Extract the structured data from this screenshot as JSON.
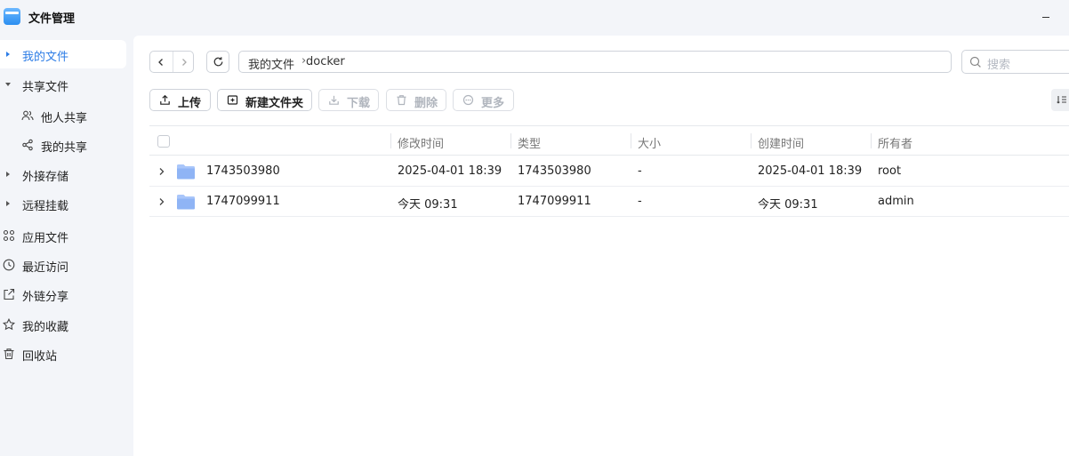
{
  "app": {
    "title": "文件管理"
  },
  "sidebar": {
    "items": [
      {
        "label": "我的文件",
        "icon": "caret-right-icon",
        "active": true
      },
      {
        "label": "共享文件",
        "icon": "caret-down-icon"
      },
      {
        "label": "他人共享",
        "icon": "people-icon",
        "sub": true
      },
      {
        "label": "我的共享",
        "icon": "share-nodes-icon",
        "sub": true
      },
      {
        "label": "外接存储",
        "icon": "caret-right-icon"
      },
      {
        "label": "远程挂载",
        "icon": "caret-right-icon"
      },
      {
        "label": "应用文件",
        "icon": "apps-grid-icon"
      },
      {
        "label": "最近访问",
        "icon": "clock-icon"
      },
      {
        "label": "外链分享",
        "icon": "external-share-icon"
      },
      {
        "label": "我的收藏",
        "icon": "star-icon"
      },
      {
        "label": "回收站",
        "icon": "trash-icon"
      }
    ]
  },
  "path": {
    "segments": [
      "我的文件",
      "docker"
    ],
    "separator": "›"
  },
  "search": {
    "placeholder": "搜索"
  },
  "toolbar": {
    "upload": "上传",
    "new_folder": "新建文件夹",
    "download": "下载",
    "delete": "删除",
    "more": "更多"
  },
  "table": {
    "columns": [
      "修改时间",
      "类型",
      "大小",
      "创建时间",
      "所有者"
    ],
    "rows": [
      {
        "name": "1743503980",
        "modified": "2025-04-01 18:39",
        "type": "1743503980",
        "size": "-",
        "created": "2025-04-01 18:39",
        "owner": "root"
      },
      {
        "name": "1747099911",
        "modified": "今天 09:31",
        "type": "1747099911",
        "size": "-",
        "created": "今天 09:31",
        "owner": "admin"
      }
    ]
  },
  "colors": {
    "accent": "#2c7ce6",
    "folder": "#8fb4f5",
    "sidebar_bg": "#f3f5f9"
  }
}
